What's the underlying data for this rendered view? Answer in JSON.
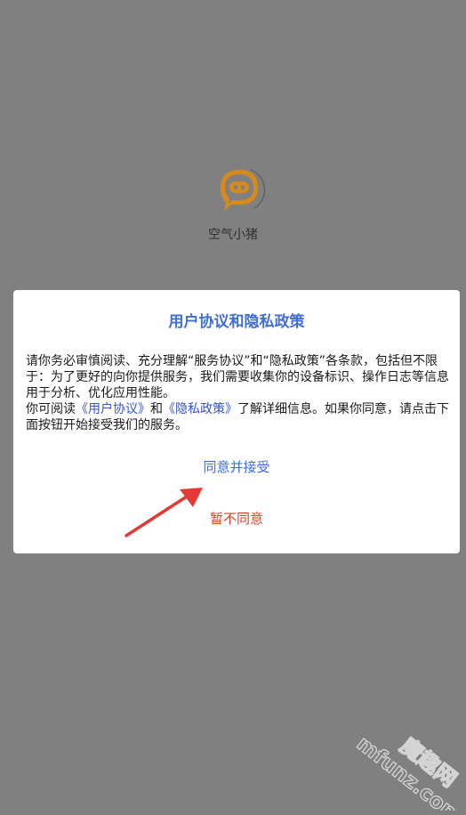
{
  "app": {
    "name": "空气小猪",
    "logo_icon": "pig-chat-icon",
    "logo_color": "#d68a1e"
  },
  "dialog": {
    "title": "用户协议和隐私政策",
    "body_line1": "请你务必审慎阅读、充分理解“服务协议”和“隐私政策”各条款，包括但不限于：为了更好的向你提供服务，我们需要收集你的设备标识、操作日志等信息用于分析、优化应用性能。",
    "body_pre_link": "你可阅读",
    "user_agreement_link": "《用户协议》",
    "and": "和",
    "privacy_policy_link": "《隐私政策》",
    "body_post_link": "了解详细信息。如果你同意，请点击下面按钮开始接受我们的服务。",
    "agree_label": "同意并接受",
    "disagree_label": "暂不同意"
  },
  "watermark": {
    "line1": "魔趣网",
    "line2": "mfunz.com"
  },
  "colors": {
    "overlay": "#808080",
    "title": "#3f6fd6",
    "link": "#3554d1",
    "disagree": "#d9402c",
    "arrow": "#e53935"
  }
}
